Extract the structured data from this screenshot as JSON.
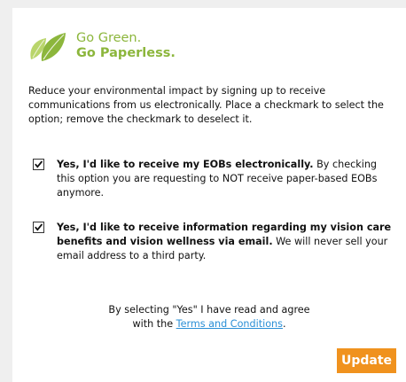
{
  "logo": {
    "line1": "Go Green.",
    "line2": "Go Paperless.",
    "icon": "leaf-icon",
    "color": "#8cb63c"
  },
  "intro_text": "Reduce your environmental impact by signing up to receive communications from us electronically. Place a checkmark to select the option; remove the checkmark to deselect it.",
  "options": [
    {
      "checked": true,
      "bold_text": "Yes, I'd like to receive my EOBs electronically.",
      "normal_text": " By checking this option you are requesting to NOT receive paper-based EOBs anymore."
    },
    {
      "checked": true,
      "bold_text": "Yes, I'd like to receive information regarding my vision care benefits and vision wellness via email.",
      "normal_text": " We will never sell your email address to a third party."
    }
  ],
  "terms": {
    "line1": "By selecting \"Yes\" I have read and agree",
    "line2_prefix": "with the ",
    "link": "Terms and Conditions",
    "line2_suffix": ".",
    "link_color": "#2a8fd6"
  },
  "update_button": {
    "label": "Update",
    "color": "#f0921e"
  }
}
